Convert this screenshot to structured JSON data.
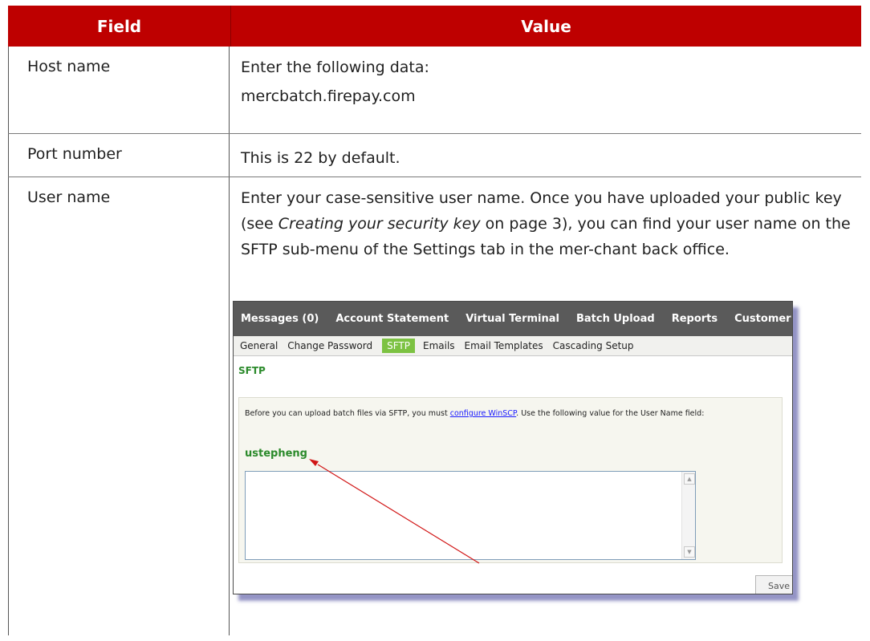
{
  "table": {
    "headers": [
      "Field",
      "Value"
    ],
    "rows": [
      {
        "field": "Host name",
        "value_line1": "Enter the following data:",
        "value_line2": "mercbatch.firepay.com"
      },
      {
        "field": "Port number",
        "value": "This is 22 by default."
      },
      {
        "field": "User name",
        "value_pre": "Enter your case-sensitive user name. Once you have uploaded your public key (see ",
        "value_link": "Creating your security key",
        "value_post": " on page 3), you can find your user name on the SFTP sub-menu of the Settings tab in the mer-chant back office."
      }
    ]
  },
  "screenshot": {
    "top_nav": [
      "Messages (0)",
      "Account Statement",
      "Virtual Terminal",
      "Batch Upload",
      "Reports",
      "Customer Profil"
    ],
    "sub_nav": [
      "General",
      "Change Password",
      "SFTP",
      "Emails",
      "Email Templates",
      "Cascading Setup"
    ],
    "active_sub_nav": "SFTP",
    "section_title": "SFTP",
    "instruction_pre": "Before you can upload batch files via SFTP, you must ",
    "instruction_link": "configure WinSCP",
    "instruction_post": ". Use the following value for the User Name field:",
    "username": "ustepheng",
    "save_label": "Save"
  },
  "colors": {
    "header_red": "#be0000",
    "nav_gray": "#5a5a5a",
    "accent_green": "#7cc242",
    "arrow_red": "#d11515"
  }
}
